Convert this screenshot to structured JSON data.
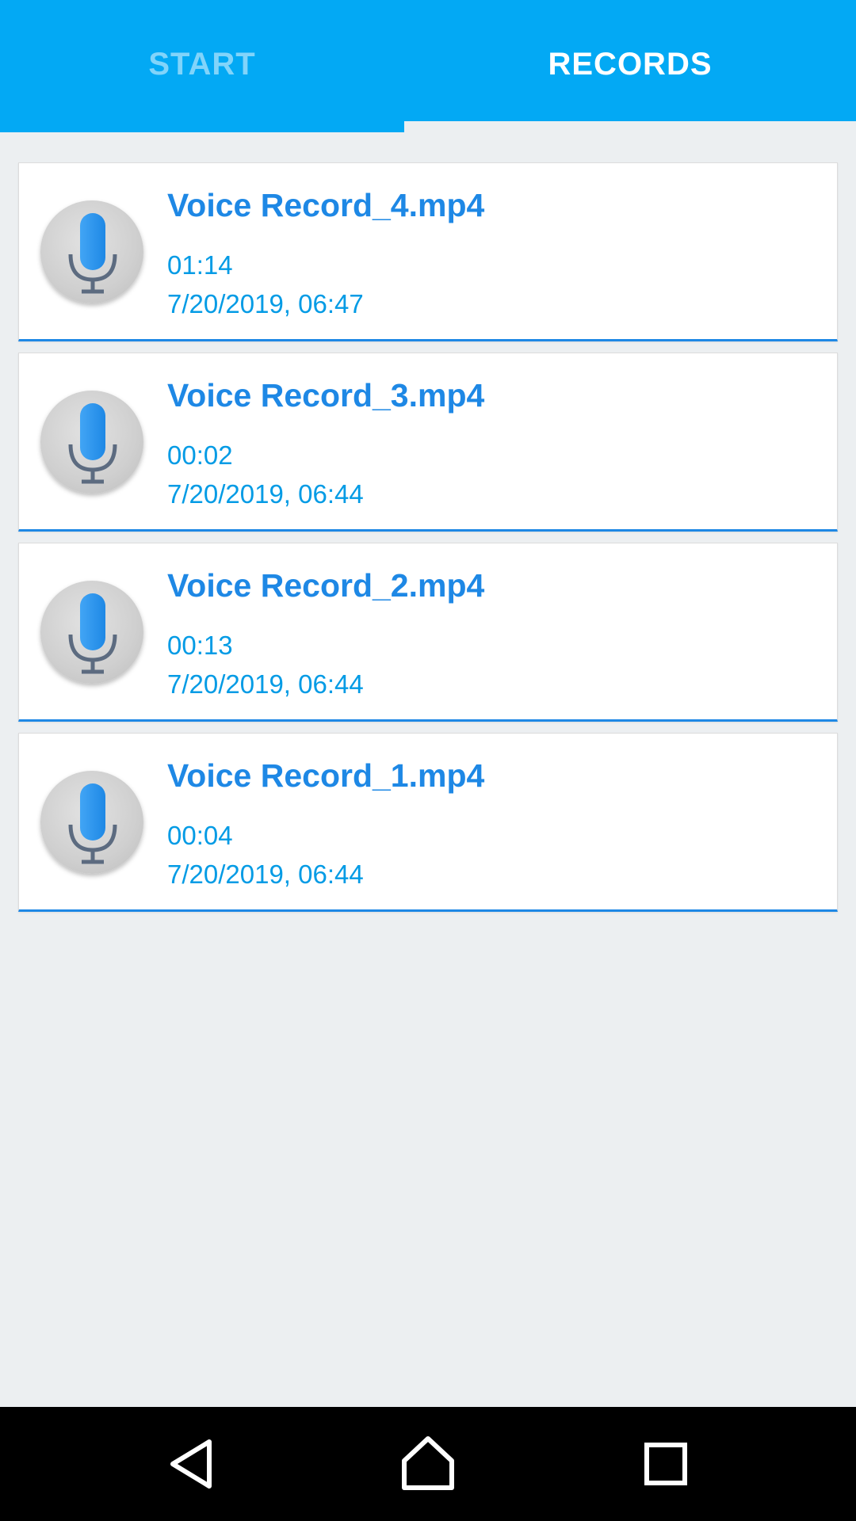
{
  "tabs": {
    "start_label": "START",
    "records_label": "RECORDS",
    "active": "RECORDS"
  },
  "records": [
    {
      "title": "Voice Record_4.mp4",
      "duration": "01:14",
      "date": "7/20/2019, 06:47",
      "icon": "microphone-icon"
    },
    {
      "title": "Voice Record_3.mp4",
      "duration": "00:02",
      "date": "7/20/2019, 06:44",
      "icon": "microphone-icon"
    },
    {
      "title": "Voice Record_2.mp4",
      "duration": "00:13",
      "date": "7/20/2019, 06:44",
      "icon": "microphone-icon"
    },
    {
      "title": "Voice Record_1.mp4",
      "duration": "00:04",
      "date": "7/20/2019, 06:44",
      "icon": "microphone-icon"
    }
  ],
  "navigation": {
    "back_icon": "back-triangle-icon",
    "home_icon": "home-icon",
    "recents_icon": "recents-square-icon"
  },
  "colors": {
    "accent": "#03a9f4",
    "title_text": "#1e88e5",
    "meta_text": "#039be5",
    "background": "#eceff1",
    "inactive_tab": "#81d4fa"
  }
}
